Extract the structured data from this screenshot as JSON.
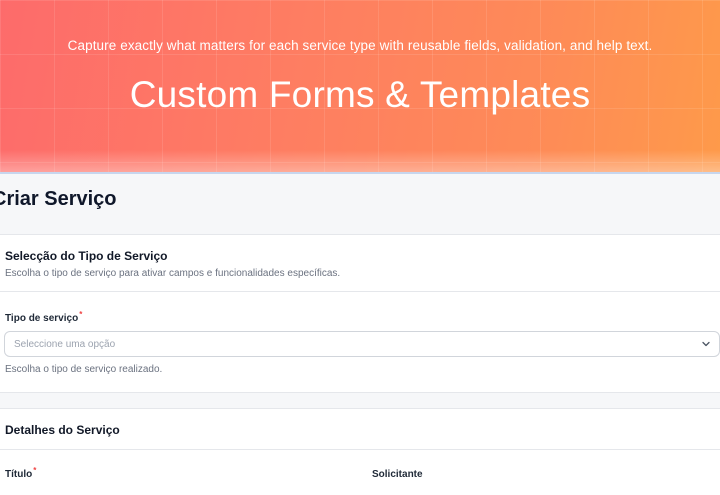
{
  "hero": {
    "subtitle": "Capture exactly what matters for each service type with reusable fields, validation, and help text.",
    "title": "Custom Forms & Templates"
  },
  "page": {
    "title": "Criar Serviço"
  },
  "service_type_section": {
    "title": "Selecção do Tipo de Serviço",
    "description": "Escolha o tipo de serviço para ativar campos e funcionalidades específicas.",
    "field": {
      "label": "Tipo de serviço",
      "required_mark": "*",
      "placeholder": "Seleccione uma opção",
      "help": "Escolha o tipo de serviço realizado."
    }
  },
  "details_section": {
    "title": "Detalhes do Serviço",
    "fields": [
      {
        "label": "Título",
        "required_mark": "*"
      },
      {
        "label": "Solicitante",
        "required_mark": ""
      }
    ]
  },
  "icons": {
    "select_chevron": "chevron-down-icon"
  },
  "colors": {
    "hero_start": "#fd6b6b",
    "hero_end": "#fe9a4a",
    "required": "#ef4444"
  }
}
